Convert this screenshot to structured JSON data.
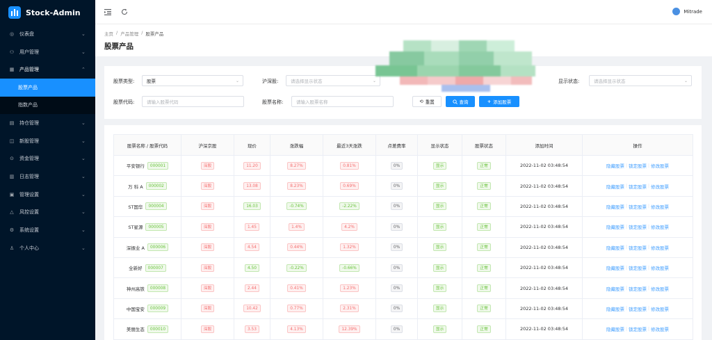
{
  "app": {
    "title": "Stock-Admin"
  },
  "user": {
    "name": "Mitrade"
  },
  "sidebar": {
    "items": [
      {
        "label": "仪表盘",
        "icon": "dashboard-icon",
        "arrow": true
      },
      {
        "label": "用户管理",
        "icon": "user-icon",
        "arrow": true
      },
      {
        "label": "产品管理",
        "icon": "product-icon",
        "arrow": true,
        "open": true,
        "children": [
          {
            "label": "股票产品",
            "active": true
          },
          {
            "label": "指数产品",
            "active": false
          }
        ]
      },
      {
        "label": "持仓管理",
        "icon": "position-icon",
        "arrow": true
      },
      {
        "label": "新股管理",
        "icon": "ipo-icon",
        "arrow": true
      },
      {
        "label": "资金管理",
        "icon": "money-icon",
        "arrow": true
      },
      {
        "label": "日志管理",
        "icon": "log-icon",
        "arrow": true
      },
      {
        "label": "管理设置",
        "icon": "admin-settings-icon",
        "arrow": true
      },
      {
        "label": "风控设置",
        "icon": "risk-icon",
        "arrow": true
      },
      {
        "label": "系统设置",
        "icon": "gear-icon",
        "arrow": true
      },
      {
        "label": "个人中心",
        "icon": "person-icon",
        "arrow": true
      }
    ]
  },
  "breadcrumb": [
    "主页",
    "/",
    "产品管理",
    "/",
    "股票产品"
  ],
  "page_title": "股票产品",
  "filters": {
    "stock_type_label": "股票类型:",
    "stock_type_value": "股票",
    "market_label": "沪深股:",
    "market_placeholder": "请选择显示状态",
    "display_status_label": "显示状态:",
    "display_status_placeholder": "请选择显示状态",
    "code_label": "股票代码:",
    "code_placeholder": "请输入股票代码",
    "name_label": "股票名称:",
    "name_placeholder": "请输入股票名称",
    "reset_label": "重置",
    "search_label": "查询",
    "add_label": "添加股票"
  },
  "table": {
    "headers": [
      "股票名称 / 股票代码",
      "沪深京股",
      "现价",
      "涨跌幅",
      "最近3天涨跌",
      "点差费率",
      "显示状态",
      "股票状态",
      "添加时间",
      "操作"
    ],
    "actions": [
      "隐藏股票",
      "锁定股票",
      "修改股票"
    ],
    "rows": [
      {
        "name": "平安银行",
        "code": "000001",
        "market": "深股",
        "price": "11.20",
        "change": "8.27%",
        "change3": "0.81%",
        "spread": "0%",
        "display": "显示",
        "status": "正常",
        "time": "2022-11-02 03:48:54",
        "up": true
      },
      {
        "name": "万 科 A",
        "code": "000002",
        "market": "深股",
        "price": "13.08",
        "change": "8.23%",
        "change3": "0.69%",
        "spread": "0%",
        "display": "显示",
        "status": "正常",
        "time": "2022-11-02 03:48:54",
        "up": true
      },
      {
        "name": "ST国华",
        "code": "000004",
        "market": "深股",
        "price": "16.03",
        "change": "-0.74%",
        "change3": "-2.22%",
        "spread": "0%",
        "display": "显示",
        "status": "正常",
        "time": "2022-11-02 03:48:54",
        "up": false
      },
      {
        "name": "ST星源",
        "code": "000005",
        "market": "深股",
        "price": "1.45",
        "change": "1.4%",
        "change3": "4.2%",
        "spread": "0%",
        "display": "显示",
        "status": "正常",
        "time": "2022-11-02 03:48:54",
        "up": true
      },
      {
        "name": "深振业 A",
        "code": "000006",
        "market": "深股",
        "price": "4.54",
        "change": "0.44%",
        "change3": "1.32%",
        "spread": "0%",
        "display": "显示",
        "status": "正常",
        "time": "2022-11-02 03:48:54",
        "up": true
      },
      {
        "name": "全新好",
        "code": "000007",
        "market": "深股",
        "price": "4.50",
        "change": "-0.22%",
        "change3": "-0.66%",
        "spread": "0%",
        "display": "显示",
        "status": "正常",
        "time": "2022-11-02 03:48:54",
        "up": false
      },
      {
        "name": "神州高铁",
        "code": "000008",
        "market": "深股",
        "price": "2.44",
        "change": "0.41%",
        "change3": "1.23%",
        "spread": "0%",
        "display": "显示",
        "status": "正常",
        "time": "2022-11-02 03:48:54",
        "up": true
      },
      {
        "name": "中国宝安",
        "code": "000009",
        "market": "深股",
        "price": "10.42",
        "change": "0.77%",
        "change3": "2.31%",
        "spread": "0%",
        "display": "显示",
        "status": "正常",
        "time": "2022-11-02 03:48:54",
        "up": true
      },
      {
        "name": "美丽生态",
        "code": "000010",
        "market": "深股",
        "price": "3.53",
        "change": "4.13%",
        "change3": "12.39%",
        "spread": "0%",
        "display": "显示",
        "status": "正常",
        "time": "2022-11-02 03:48:54",
        "up": true
      }
    ]
  },
  "colors": {
    "primary": "#1890ff",
    "sidebar_bg": "#001529",
    "up": "#f56c6c",
    "down": "#67c23a"
  }
}
